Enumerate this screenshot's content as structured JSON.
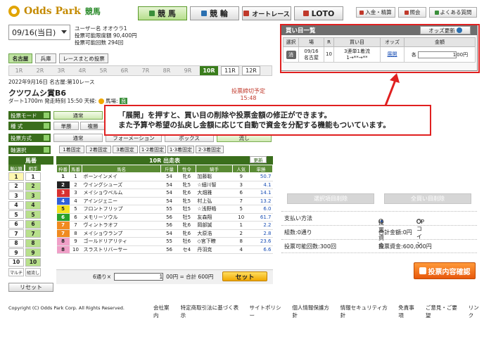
{
  "header": {
    "logo_text": "Odds Park",
    "logo_sub": "競馬",
    "tabs": [
      {
        "label": "競 馬"
      },
      {
        "label": "競 輪"
      },
      {
        "label": "オートレース"
      },
      {
        "label": "LOTO"
      }
    ],
    "buttons": [
      {
        "label": "入金・精算"
      },
      {
        "label": "照会"
      },
      {
        "label": "よくある質問"
      }
    ]
  },
  "left": {
    "date_value": "09/16(当日)",
    "user": {
      "line1": "ユーザー名 オオウラ1",
      "line2": "投票可能限度額 90,400円",
      "line3": "投票可能回数 294回"
    },
    "venue_tabs": [
      "名古屋",
      "兵庫",
      "レースまとめ投票"
    ],
    "race_tabs": [
      "1R",
      "2R",
      "3R",
      "4R",
      "5R",
      "6R",
      "7R",
      "8R",
      "9R",
      "10R",
      "11R",
      "12R"
    ],
    "race_info": {
      "line1": "2022年9月16日 名古屋:第10レース",
      "name": "クツワムシ賞B6",
      "line2": "ダート1700m 発走時刻 15:50 天候:",
      "baba": "馬場:",
      "baba_value": "良",
      "deadline_label": "投票締切予定",
      "deadline_time": "15:48"
    },
    "rows": [
      {
        "label": "投票モード",
        "options": [
          "通常"
        ]
      },
      {
        "label": "種 式",
        "options": [
          "単勝",
          "複勝"
        ]
      },
      {
        "label": "投票方式",
        "options": [
          "通常",
          "フォーメーション",
          "ボックス",
          "流し"
        ]
      },
      {
        "label": "軸選択",
        "options": [
          "1着固定",
          "2着固定",
          "3着固定",
          "1·2着固定",
          "1·3着固定",
          "2·3着固定"
        ]
      }
    ],
    "grid": {
      "title": "馬番",
      "sub1": "軸1頭",
      "sub2": "相手",
      "numbers": [
        "1",
        "2",
        "3",
        "4",
        "5",
        "6",
        "7",
        "8",
        "9",
        "10"
      ],
      "multi_label": "マルチ",
      "kumi_label": "組流し",
      "reset_label": "リセット"
    },
    "table": {
      "title": "10R 出走表",
      "update_label": "更新",
      "headers": [
        "枠番",
        "馬番",
        "馬名",
        "斤量",
        "性令",
        "騎手",
        "人気",
        "単勝"
      ],
      "rows": [
        {
          "waku": "1",
          "num": "1",
          "name": "ボーンインメイ",
          "kin": "54",
          "sei": "牝6",
          "jockey": "加藤聡",
          "pop": "9",
          "odds": "50.7",
          "color": "#ffffff",
          "fg": "#222"
        },
        {
          "waku": "2",
          "num": "2",
          "name": "ウイングシューズ",
          "kin": "54",
          "sei": "牝5",
          "jockey": "☆細川智",
          "pop": "3",
          "odds": "4.1",
          "color": "#222222",
          "fg": "#fff"
        },
        {
          "waku": "3",
          "num": "3",
          "name": "メイショウベルム",
          "kin": "54",
          "sei": "牝6",
          "jockey": "大畑雅",
          "pop": "6",
          "odds": "14.1",
          "color": "#d83030",
          "fg": "#fff"
        },
        {
          "waku": "4",
          "num": "4",
          "name": "アインジェニー",
          "kin": "54",
          "sei": "牝5",
          "jockey": "村上弘",
          "pop": "7",
          "odds": "13.2",
          "color": "#3060d8",
          "fg": "#fff"
        },
        {
          "waku": "5",
          "num": "5",
          "name": "フロントフリップ",
          "kin": "55",
          "sei": "牡5",
          "jockey": "☆浅野皓",
          "pop": "5",
          "odds": "6.0",
          "color": "#f2e020",
          "fg": "#222"
        },
        {
          "waku": "6",
          "num": "6",
          "name": "メモリーソウル",
          "kin": "56",
          "sei": "牡5",
          "jockey": "友森翔",
          "pop": "10",
          "odds": "61.7",
          "color": "#28a028",
          "fg": "#fff"
        },
        {
          "waku": "7",
          "num": "7",
          "name": "ヴィントラオフ",
          "kin": "56",
          "sei": "牝6",
          "jockey": "岡部誠",
          "pop": "1",
          "odds": "2.2",
          "color": "#f08a20",
          "fg": "#fff"
        },
        {
          "waku": "7",
          "num": "8",
          "name": "メイショウランプ",
          "kin": "54",
          "sei": "牝6",
          "jockey": "大原浩",
          "pop": "2",
          "odds": "2.8",
          "color": "#f08a20",
          "fg": "#fff"
        },
        {
          "waku": "8",
          "num": "9",
          "name": "ゴールドリアリティ",
          "kin": "55",
          "sei": "牡6",
          "jockey": "◇宮下瞭",
          "pop": "8",
          "odds": "23.6",
          "color": "#f0a0c8",
          "fg": "#222"
        },
        {
          "waku": "8",
          "num": "10",
          "name": "スラストリバーサー",
          "kin": "56",
          "sei": "セ4",
          "jockey": "丹羽克",
          "pop": "4",
          "odds": "6.6",
          "color": "#f0a0c8",
          "fg": "#222"
        }
      ]
    },
    "amount": {
      "prefix": "6通り×",
      "value": "1",
      "suffix": "00円 = 合計 600円",
      "set_label": "セット"
    }
  },
  "right": {
    "panel_title": "買い目一覧",
    "odds_button": "オッズ更新",
    "headers": [
      "選択",
      "場",
      "R",
      "買い目",
      "オッズ",
      "金額"
    ],
    "bet": {
      "delete": "消",
      "date": "09/16",
      "venue": "名古屋",
      "race": "10",
      "type": "3連単1着流",
      "combo": "1→**→**",
      "odds": "展開",
      "amount_prefix": "各",
      "amount_value": "1",
      "amount_suffix": "00円"
    },
    "delete_selected": "選択項目削除",
    "delete_all": "全買い目削除",
    "pay_label": "支払い方法",
    "pay_option1": "投票資金",
    "pay_option2": "OPコイン",
    "count_label": "組数:0通り",
    "total_label": "合計金額:0円",
    "vote_count": "投票可能回数:300回",
    "vote_fund": "投票資金:600,000円",
    "confirm_label": "投票内容確認"
  },
  "callout": {
    "line1": "「展開」を押すと、買い目の削除や投票金額の修正ができます。",
    "line2": "また予算や希望の払戻し金額に応じて自動で資金を分配する機能もついています。"
  },
  "footer": {
    "copyright": "Copyright (C) Odds Park Corp. All Rights Reserved.",
    "links": [
      "会社案内",
      "特定商取引法に基づく表示",
      "サイトポリシー",
      "個人情報保護方針",
      "情報セキュリティ方針",
      "免責事項",
      "ご意見・ご要望",
      "リンク"
    ]
  }
}
